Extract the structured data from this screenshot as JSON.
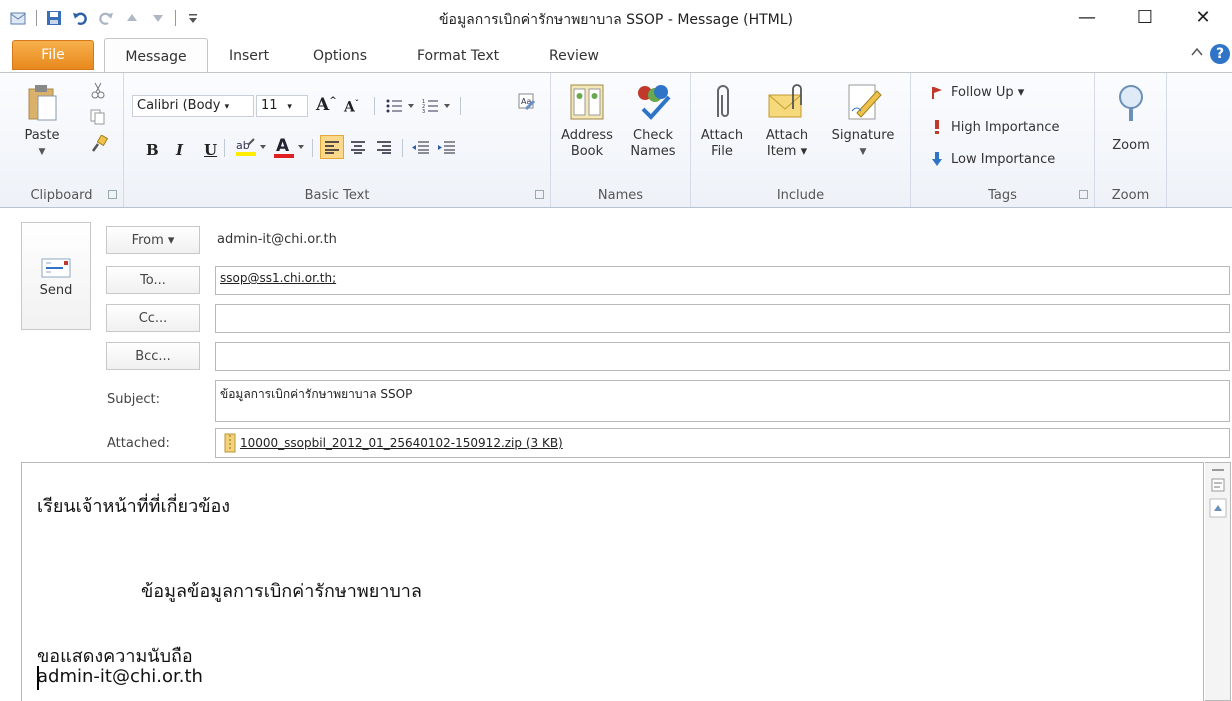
{
  "window": {
    "title": "ข้อมูลการเบิกค่ารักษาพยาบาล SSOP  -  Message (HTML)",
    "minimize_glyph": "—",
    "maximize_glyph": "☐",
    "close_glyph": "✕"
  },
  "ribbon_tabs": {
    "file": "File",
    "message": "Message",
    "insert": "Insert",
    "options": "Options",
    "format_text": "Format Text",
    "review": "Review"
  },
  "ribbon": {
    "clipboard": {
      "paste": "Paste",
      "label": "Clipboard"
    },
    "basic_text": {
      "font_name": "Calibri (Body",
      "font_size": "11",
      "label": "Basic Text"
    },
    "names": {
      "address_book_1": "Address",
      "address_book_2": "Book",
      "check_names_1": "Check",
      "check_names_2": "Names",
      "label": "Names"
    },
    "include": {
      "attach_file_1": "Attach",
      "attach_file_2": "File",
      "attach_item_1": "Attach",
      "attach_item_2": "Item ▾",
      "signature": "Signature",
      "label": "Include"
    },
    "tags": {
      "follow_up": "Follow Up ▾",
      "high_importance": "High Importance",
      "low_importance": "Low Importance",
      "label": "Tags"
    },
    "zoom": {
      "zoom_button": "Zoom",
      "label": "Zoom"
    }
  },
  "compose": {
    "send": "Send",
    "from_button": "From ▾",
    "from_value": "admin-it@chi.or.th",
    "to_button": "To...",
    "to_value": "ssop@ss1.chi.or.th;",
    "cc_button": "Cc...",
    "cc_value": "",
    "bcc_button": "Bcc...",
    "bcc_value": "",
    "subject_label": "Subject:",
    "subject_value": "ข้อมูลการเบิกค่ารักษาพยาบาล SSOP",
    "attached_label": "Attached:",
    "attachment": "10000_ssopbil_2012_01_25640102-150912.zip (3 KB)"
  },
  "body": {
    "line1": "เรียนเจ้าหน้าที่ที่เกี่ยวข้อง",
    "line2": "ข้อมูลข้อมูลการเบิกค่ารักษาพยาบาล",
    "line3": "ขอแสดงความนับถือ",
    "line4": "admin-it@chi.or.th"
  },
  "colors": {
    "file_tab": "#e8891d",
    "help_icon": "#2f74c6",
    "follow_up_flag": "#c0392b",
    "high_importance": "#c0392b",
    "low_importance": "#2f74c6"
  }
}
